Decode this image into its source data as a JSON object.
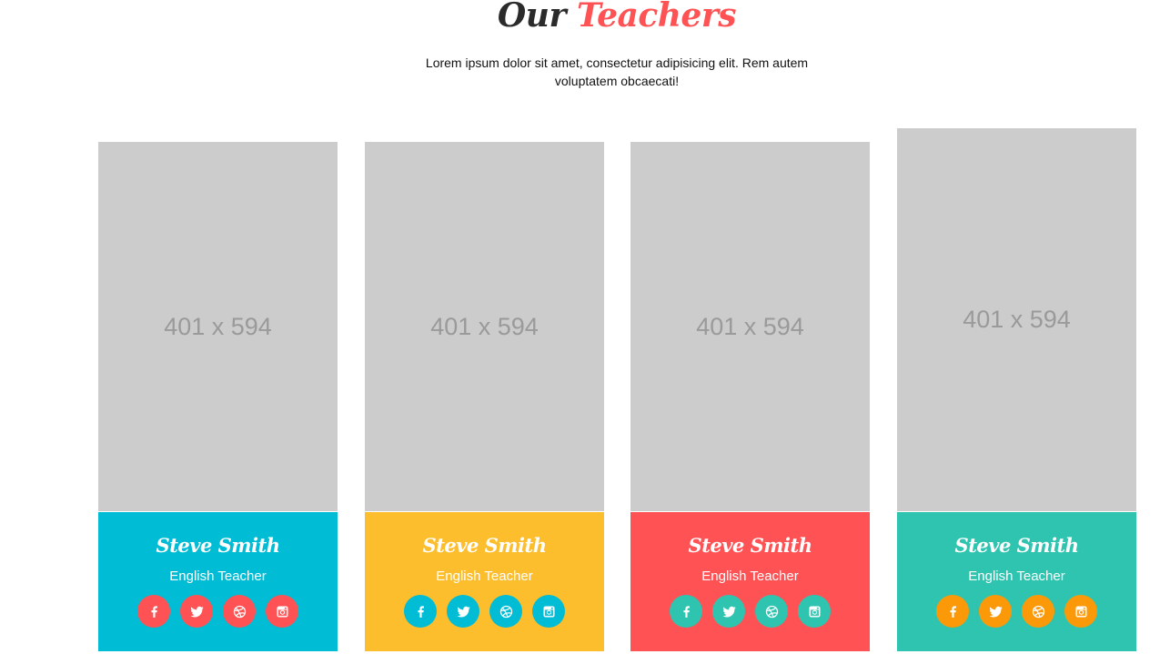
{
  "section": {
    "title_part1": "Our",
    "title_part2": "Teachers",
    "subtitle": "Lorem ipsum dolor sit amet, consectetur adipisicing elit. Rem autem voluptatem obcaecati!"
  },
  "teachers": [
    {
      "photo_placeholder": "401 x 594",
      "name": "Steve Smith",
      "role": "English Teacher",
      "card_color": "#00bcd4",
      "icon_color": "#fe5254",
      "socials": [
        "facebook-icon",
        "twitter-icon",
        "dribbble-icon",
        "instagram-icon"
      ]
    },
    {
      "photo_placeholder": "401 x 594",
      "name": "Steve Smith",
      "role": "English Teacher",
      "card_color": "#fdbe2d",
      "icon_color": "#00bcd4",
      "socials": [
        "facebook-icon",
        "twitter-icon",
        "dribbble-icon",
        "instagram-icon"
      ]
    },
    {
      "photo_placeholder": "401 x 594",
      "name": "Steve Smith",
      "role": "English Teacher",
      "card_color": "#fe5254",
      "icon_color": "#2ec4b0",
      "socials": [
        "facebook-icon",
        "twitter-icon",
        "dribbble-icon",
        "instagram-icon"
      ]
    },
    {
      "photo_placeholder": "401 x 594",
      "name": "Steve Smith",
      "role": "English Teacher",
      "card_color": "#2ec4b0",
      "icon_color": "#fb9908",
      "socials": [
        "facebook-icon",
        "twitter-icon",
        "dribbble-icon",
        "instagram-icon"
      ]
    }
  ]
}
